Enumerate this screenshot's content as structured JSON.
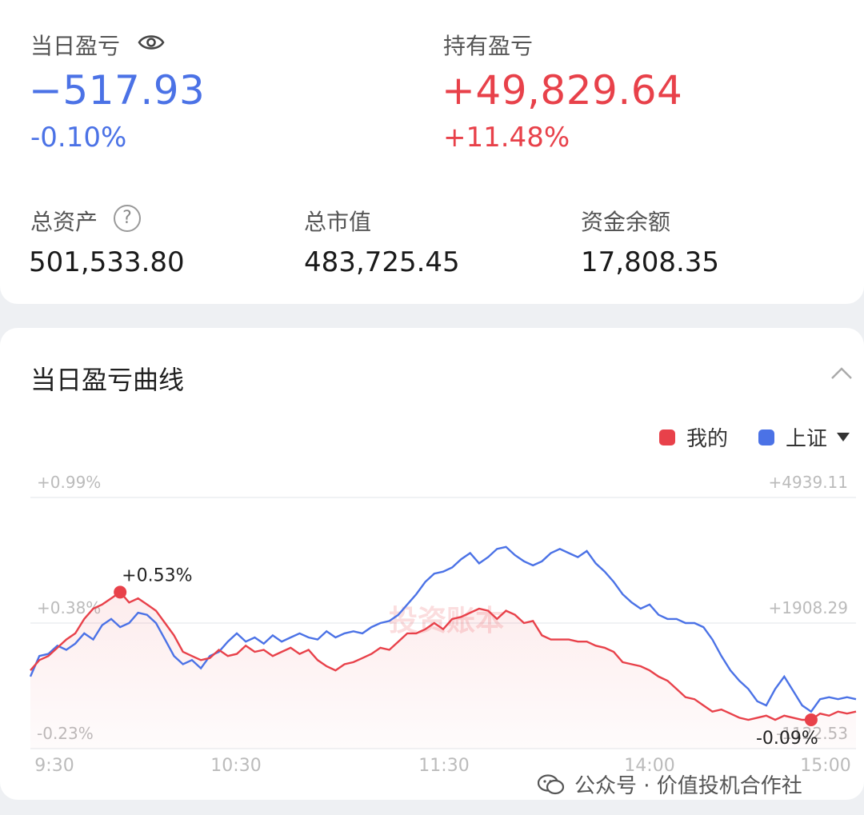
{
  "summary": {
    "daily_pnl_label": "当日盈亏",
    "daily_pnl_value": "−517.93",
    "daily_pnl_pct": "-0.10%",
    "holding_pnl_label": "持有盈亏",
    "holding_pnl_value": "+49,829.64",
    "holding_pnl_pct": "+11.48%",
    "total_assets_label": "总资产",
    "total_assets_value": "501,533.80",
    "market_value_label": "总市值",
    "market_value_value": "483,725.45",
    "cash_balance_label": "资金余额",
    "cash_balance_value": "17,808.35"
  },
  "chart_card": {
    "title": "当日盈亏曲线",
    "legend": [
      {
        "name": "我的",
        "color": "#e8414a"
      },
      {
        "name": "上证",
        "color": "#4b72e6"
      }
    ],
    "watermark": "投资账本",
    "icons": [
      "eye-icon",
      "help-icon",
      "chevron-up-icon",
      "caret-down-icon",
      "wechat-icon"
    ]
  },
  "chart_data": {
    "type": "line",
    "x_ticks": [
      "9:30",
      "10:30",
      "11:30",
      "14:00",
      "15:00"
    ],
    "y_left_ticks": [
      "+0.99%",
      "+0.38%",
      "-0.23%"
    ],
    "y_right_ticks": [
      "+4939.11",
      "+1908.29",
      "-1122.53"
    ],
    "ylim": [
      -0.23,
      0.99
    ],
    "annotations": [
      {
        "series": "我的",
        "text": "+0.53%",
        "x_index": 10,
        "y": 0.53
      },
      {
        "series": "我的",
        "text": "-0.09%",
        "x_index": 87,
        "y": -0.09
      }
    ],
    "series": [
      {
        "name": "我的",
        "color": "#e8414a",
        "values": [
          0.15,
          0.2,
          0.22,
          0.26,
          0.3,
          0.33,
          0.4,
          0.45,
          0.47,
          0.5,
          0.53,
          0.48,
          0.5,
          0.47,
          0.44,
          0.38,
          0.32,
          0.24,
          0.22,
          0.2,
          0.21,
          0.25,
          0.22,
          0.23,
          0.27,
          0.24,
          0.25,
          0.22,
          0.24,
          0.26,
          0.23,
          0.25,
          0.2,
          0.17,
          0.15,
          0.18,
          0.19,
          0.21,
          0.23,
          0.26,
          0.25,
          0.29,
          0.33,
          0.33,
          0.35,
          0.38,
          0.35,
          0.4,
          0.41,
          0.43,
          0.45,
          0.44,
          0.4,
          0.44,
          0.42,
          0.38,
          0.39,
          0.32,
          0.3,
          0.3,
          0.3,
          0.29,
          0.29,
          0.27,
          0.26,
          0.24,
          0.19,
          0.18,
          0.17,
          0.15,
          0.12,
          0.1,
          0.06,
          0.02,
          0.01,
          -0.02,
          -0.05,
          -0.04,
          -0.06,
          -0.08,
          -0.09,
          -0.08,
          -0.07,
          -0.09,
          -0.07,
          -0.08,
          -0.09,
          -0.09,
          -0.06,
          -0.07,
          -0.05,
          -0.06,
          -0.05
        ]
      },
      {
        "name": "上证",
        "color": "#4b72e6",
        "values": [
          0.12,
          0.22,
          0.23,
          0.27,
          0.25,
          0.28,
          0.33,
          0.3,
          0.37,
          0.4,
          0.36,
          0.38,
          0.43,
          0.42,
          0.38,
          0.3,
          0.22,
          0.18,
          0.2,
          0.16,
          0.22,
          0.24,
          0.29,
          0.33,
          0.29,
          0.31,
          0.28,
          0.32,
          0.29,
          0.31,
          0.33,
          0.31,
          0.3,
          0.34,
          0.31,
          0.33,
          0.34,
          0.33,
          0.36,
          0.38,
          0.39,
          0.42,
          0.47,
          0.52,
          0.58,
          0.62,
          0.63,
          0.65,
          0.69,
          0.72,
          0.67,
          0.7,
          0.74,
          0.75,
          0.71,
          0.68,
          0.66,
          0.68,
          0.72,
          0.74,
          0.72,
          0.7,
          0.73,
          0.67,
          0.63,
          0.58,
          0.52,
          0.48,
          0.45,
          0.47,
          0.42,
          0.4,
          0.4,
          0.38,
          0.38,
          0.36,
          0.3,
          0.22,
          0.15,
          0.1,
          0.06,
          0.0,
          -0.02,
          0.06,
          0.12,
          0.05,
          -0.02,
          -0.05,
          0.01,
          0.02,
          0.01,
          0.02,
          0.01
        ]
      }
    ]
  }
}
